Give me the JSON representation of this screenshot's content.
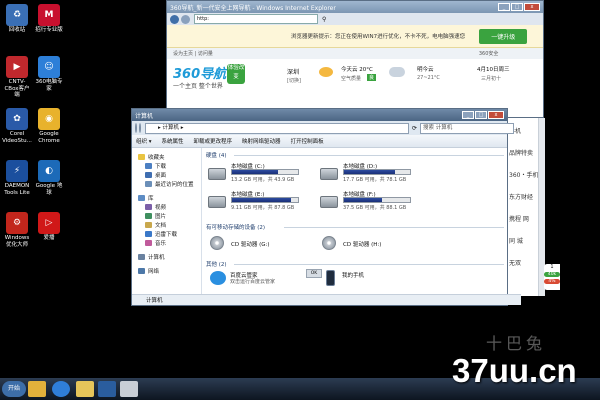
{
  "desktop": {
    "icons": [
      {
        "label": "回收站",
        "color": "#3a6fb5",
        "glyph": "♻"
      },
      {
        "label": "招行专业版",
        "color": "#c8102e",
        "glyph": "M"
      },
      {
        "label": "CNTV-CBox客户端",
        "color": "#c0282d",
        "glyph": "▶"
      },
      {
        "label": "360电脑专家",
        "color": "#2d7fd8",
        "glyph": "☺"
      },
      {
        "label": "Corel VideoStu...",
        "color": "#2a5aa8",
        "glyph": "✿"
      },
      {
        "label": "Google Chrome",
        "color": "#e8b22c",
        "glyph": "◉"
      },
      {
        "label": "DAEMON Tools Lite",
        "color": "#1b4f9e",
        "glyph": "⚡"
      },
      {
        "label": "Google 地球",
        "color": "#1c6ab8",
        "glyph": "◐"
      },
      {
        "label": "Windows优化大师",
        "color": "#c2261c",
        "glyph": "⚙"
      },
      {
        "label": "爱播",
        "color": "#d01818",
        "glyph": "▷"
      }
    ]
  },
  "ie": {
    "title": "360导航_新一代安全上网导航 - Windows Internet Explorer",
    "url": "http:",
    "notice": "浏览器更新提示：您正在使用WIN7进行优化，不卡不死，电电脑强速您",
    "upgrade_label": "一键升级",
    "tab1": "设为主页 | 访问量",
    "tab2": "360安全",
    "logo": "360导航",
    "slogan": "一个主页 整个世界",
    "badge": "体验改变",
    "city": "深圳",
    "city_sub": "[切换]",
    "today": "今天云 20°C",
    "today_aq": "空气质量",
    "aq_badge": "良",
    "tomorrow": "明今云",
    "tomorrow_temp": "27~21°C",
    "date": "4月10日周三",
    "lunar": "三月初十",
    "right_items": [
      "手机",
      "品牌特卖",
      "360・手机",
      "东方财经",
      "携程 网",
      "同 城",
      "无双"
    ],
    "side_label": "1",
    "chip1": "40k",
    "chip2": "4%"
  },
  "explorer": {
    "title": "计算机",
    "address": "计算机",
    "search_placeholder": "搜索 计算机",
    "toolbar": [
      "组织 ▾",
      "系统属性",
      "卸载或更改程序",
      "映射网络驱动器",
      "打开控制面板"
    ],
    "nav": [
      {
        "label": "收藏夹",
        "color": "#e9c441",
        "type": "group"
      },
      {
        "label": "下载",
        "color": "#4c7fc2",
        "type": "item"
      },
      {
        "label": "桌面",
        "color": "#3f6eb1",
        "type": "item"
      },
      {
        "label": "最近访问的位置",
        "color": "#6b8fb8",
        "type": "item"
      },
      {
        "label": "库",
        "color": "#5d8cc4",
        "type": "group"
      },
      {
        "label": "视频",
        "color": "#7b5fa8",
        "type": "item"
      },
      {
        "label": "图片",
        "color": "#3f8f5f",
        "type": "item"
      },
      {
        "label": "文档",
        "color": "#c9a84d",
        "type": "item"
      },
      {
        "label": "迅雷下载",
        "color": "#3a78c8",
        "type": "item"
      },
      {
        "label": "音乐",
        "color": "#c05a9b",
        "type": "item"
      },
      {
        "label": "计算机",
        "color": "#6a82a0",
        "type": "group"
      },
      {
        "label": "网络",
        "color": "#4d78a8",
        "type": "group"
      }
    ],
    "section_disks": "硬盘 (4)",
    "disks": [
      {
        "name": "本地磁盘 (C:)",
        "cap": "13.2 GB 可用，共 43.9 GB",
        "used": 0.7
      },
      {
        "name": "本地磁盘 (D:)",
        "cap": "17.7 GB 可用，共 78.1 GB",
        "used": 0.77
      },
      {
        "name": "本地磁盘 (E:)",
        "cap": "9.11 GB 可用，共 87.8 GB",
        "used": 0.9
      },
      {
        "name": "本地磁盘 (F:)",
        "cap": "37.5 GB 可用，共 88.1 GB",
        "used": 0.57
      }
    ],
    "section_removable": "有可移动存储的设备 (2)",
    "removable": [
      {
        "name": "CD 驱动器 (G:)"
      },
      {
        "name": "CD 驱动器 (H:)"
      }
    ],
    "section_other": "其他 (2)",
    "other": [
      {
        "name": "百度云管家",
        "sub": "双击运行百度云管家"
      },
      {
        "name": "我的手机",
        "sub": ""
      }
    ],
    "overlay_chip": "OK",
    "status": "计算机"
  },
  "taskbar": {
    "start_label": "开始"
  },
  "watermark": {
    "text": "37uu.cn",
    "faint": "十巴兔"
  }
}
